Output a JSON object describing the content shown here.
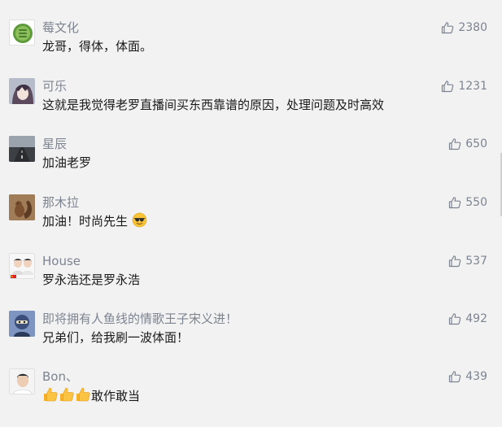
{
  "comments": [
    {
      "user": "莓文化",
      "text": "龙哥，得体，体面。",
      "likes": "2380",
      "avatar": "green-bug-avatar"
    },
    {
      "user": "可乐",
      "text": "这就是我觉得老罗直播间买东西靠谱的原因，处理问题及时高效",
      "likes": "1231",
      "avatar": "anime-avatar"
    },
    {
      "user": "星辰",
      "text": "加油老罗",
      "likes": "650",
      "avatar": "road-avatar"
    },
    {
      "user": "那木拉",
      "text": "加油！时尚先生",
      "likes": "550",
      "avatar": "squirrel-avatar",
      "emoji": "sunglasses-emoji"
    },
    {
      "user": "House",
      "text": "罗永浩还是罗永浩",
      "likes": "537",
      "avatar": "two-men-avatar"
    },
    {
      "user": "即将拥有人鱼线的情歌王子宋义进！",
      "text": "兄弟们，给我刷一波体面！",
      "likes": "492",
      "avatar": "cartoon-avatar"
    },
    {
      "user": "Bon、",
      "text": "敢作敢当",
      "likes": "439",
      "avatar": "man-avatar",
      "emoji": "thumbs-up-emoji"
    }
  ]
}
